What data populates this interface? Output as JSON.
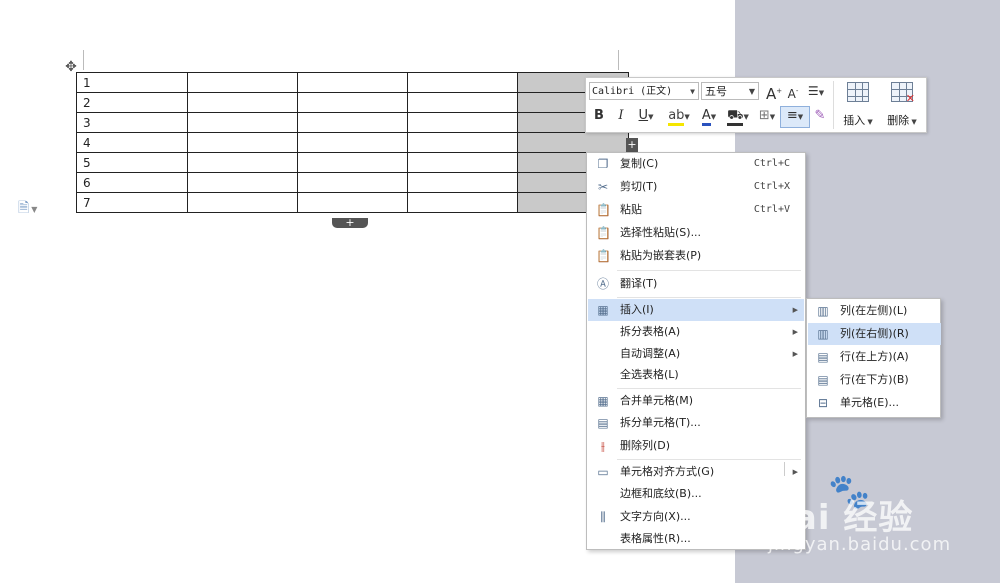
{
  "document": {
    "table_rows": [
      "1",
      "2",
      "3",
      "4",
      "5",
      "6",
      "7"
    ],
    "add_row_symbol": "+",
    "add_col_symbol": "+"
  },
  "toolbar": {
    "font_name": "Calibri (正文)",
    "font_size": "五号",
    "bold": "B",
    "italic": "I",
    "underline": "U",
    "grow_font": "A",
    "shrink_font": "A",
    "font_color": "A",
    "insert_label": "插入",
    "delete_label": "删除"
  },
  "context_menu": {
    "items": [
      {
        "label": "复制(C)",
        "shortcut": "Ctrl+C",
        "icon": "copy-icon"
      },
      {
        "label": "剪切(T)",
        "shortcut": "Ctrl+X",
        "icon": "scissors-icon"
      },
      {
        "label": "粘贴",
        "shortcut": "Ctrl+V",
        "icon": "paste-icon"
      },
      {
        "label": "选择性粘贴(S)...",
        "icon": "paste-special-icon"
      },
      {
        "label": "粘贴为嵌套表(P)",
        "icon": "paste-nested-table-icon"
      },
      {
        "label": "翻译(T)",
        "icon": "translate-icon"
      },
      {
        "label": "插入(I)",
        "icon": "table-insert-icon"
      },
      {
        "label": "拆分表格(A)"
      },
      {
        "label": "自动调整(A)"
      },
      {
        "label": "全选表格(L)"
      },
      {
        "label": "合并单元格(M)",
        "icon": "merge-cells-icon"
      },
      {
        "label": "拆分单元格(T)...",
        "icon": "split-cells-icon"
      },
      {
        "label": "删除列(D)",
        "icon": "delete-column-icon"
      },
      {
        "label": "单元格对齐方式(G)",
        "icon": "cell-align-icon"
      },
      {
        "label": "边框和底纹(B)..."
      },
      {
        "label": "文字方向(X)...",
        "icon": "text-direction-icon"
      },
      {
        "label": "表格属性(R)..."
      }
    ]
  },
  "insert_submenu": {
    "items": [
      {
        "label": "列(在左侧)(L)",
        "icon": "insert-column-left-icon"
      },
      {
        "label": "列(在右侧)(R)",
        "icon": "insert-column-right-icon"
      },
      {
        "label": "行(在上方)(A)",
        "icon": "insert-row-above-icon"
      },
      {
        "label": "行(在下方)(B)",
        "icon": "insert-row-below-icon"
      },
      {
        "label": "单元格(E)...",
        "icon": "insert-cell-icon"
      }
    ]
  },
  "watermark": {
    "brand": "Bai 经验",
    "url": "jingyan.baidu.com"
  },
  "colors": {
    "background_gray": "#c7c9d4",
    "highlight": "#cfe0f7",
    "selected_column": "#c9c9c9"
  }
}
